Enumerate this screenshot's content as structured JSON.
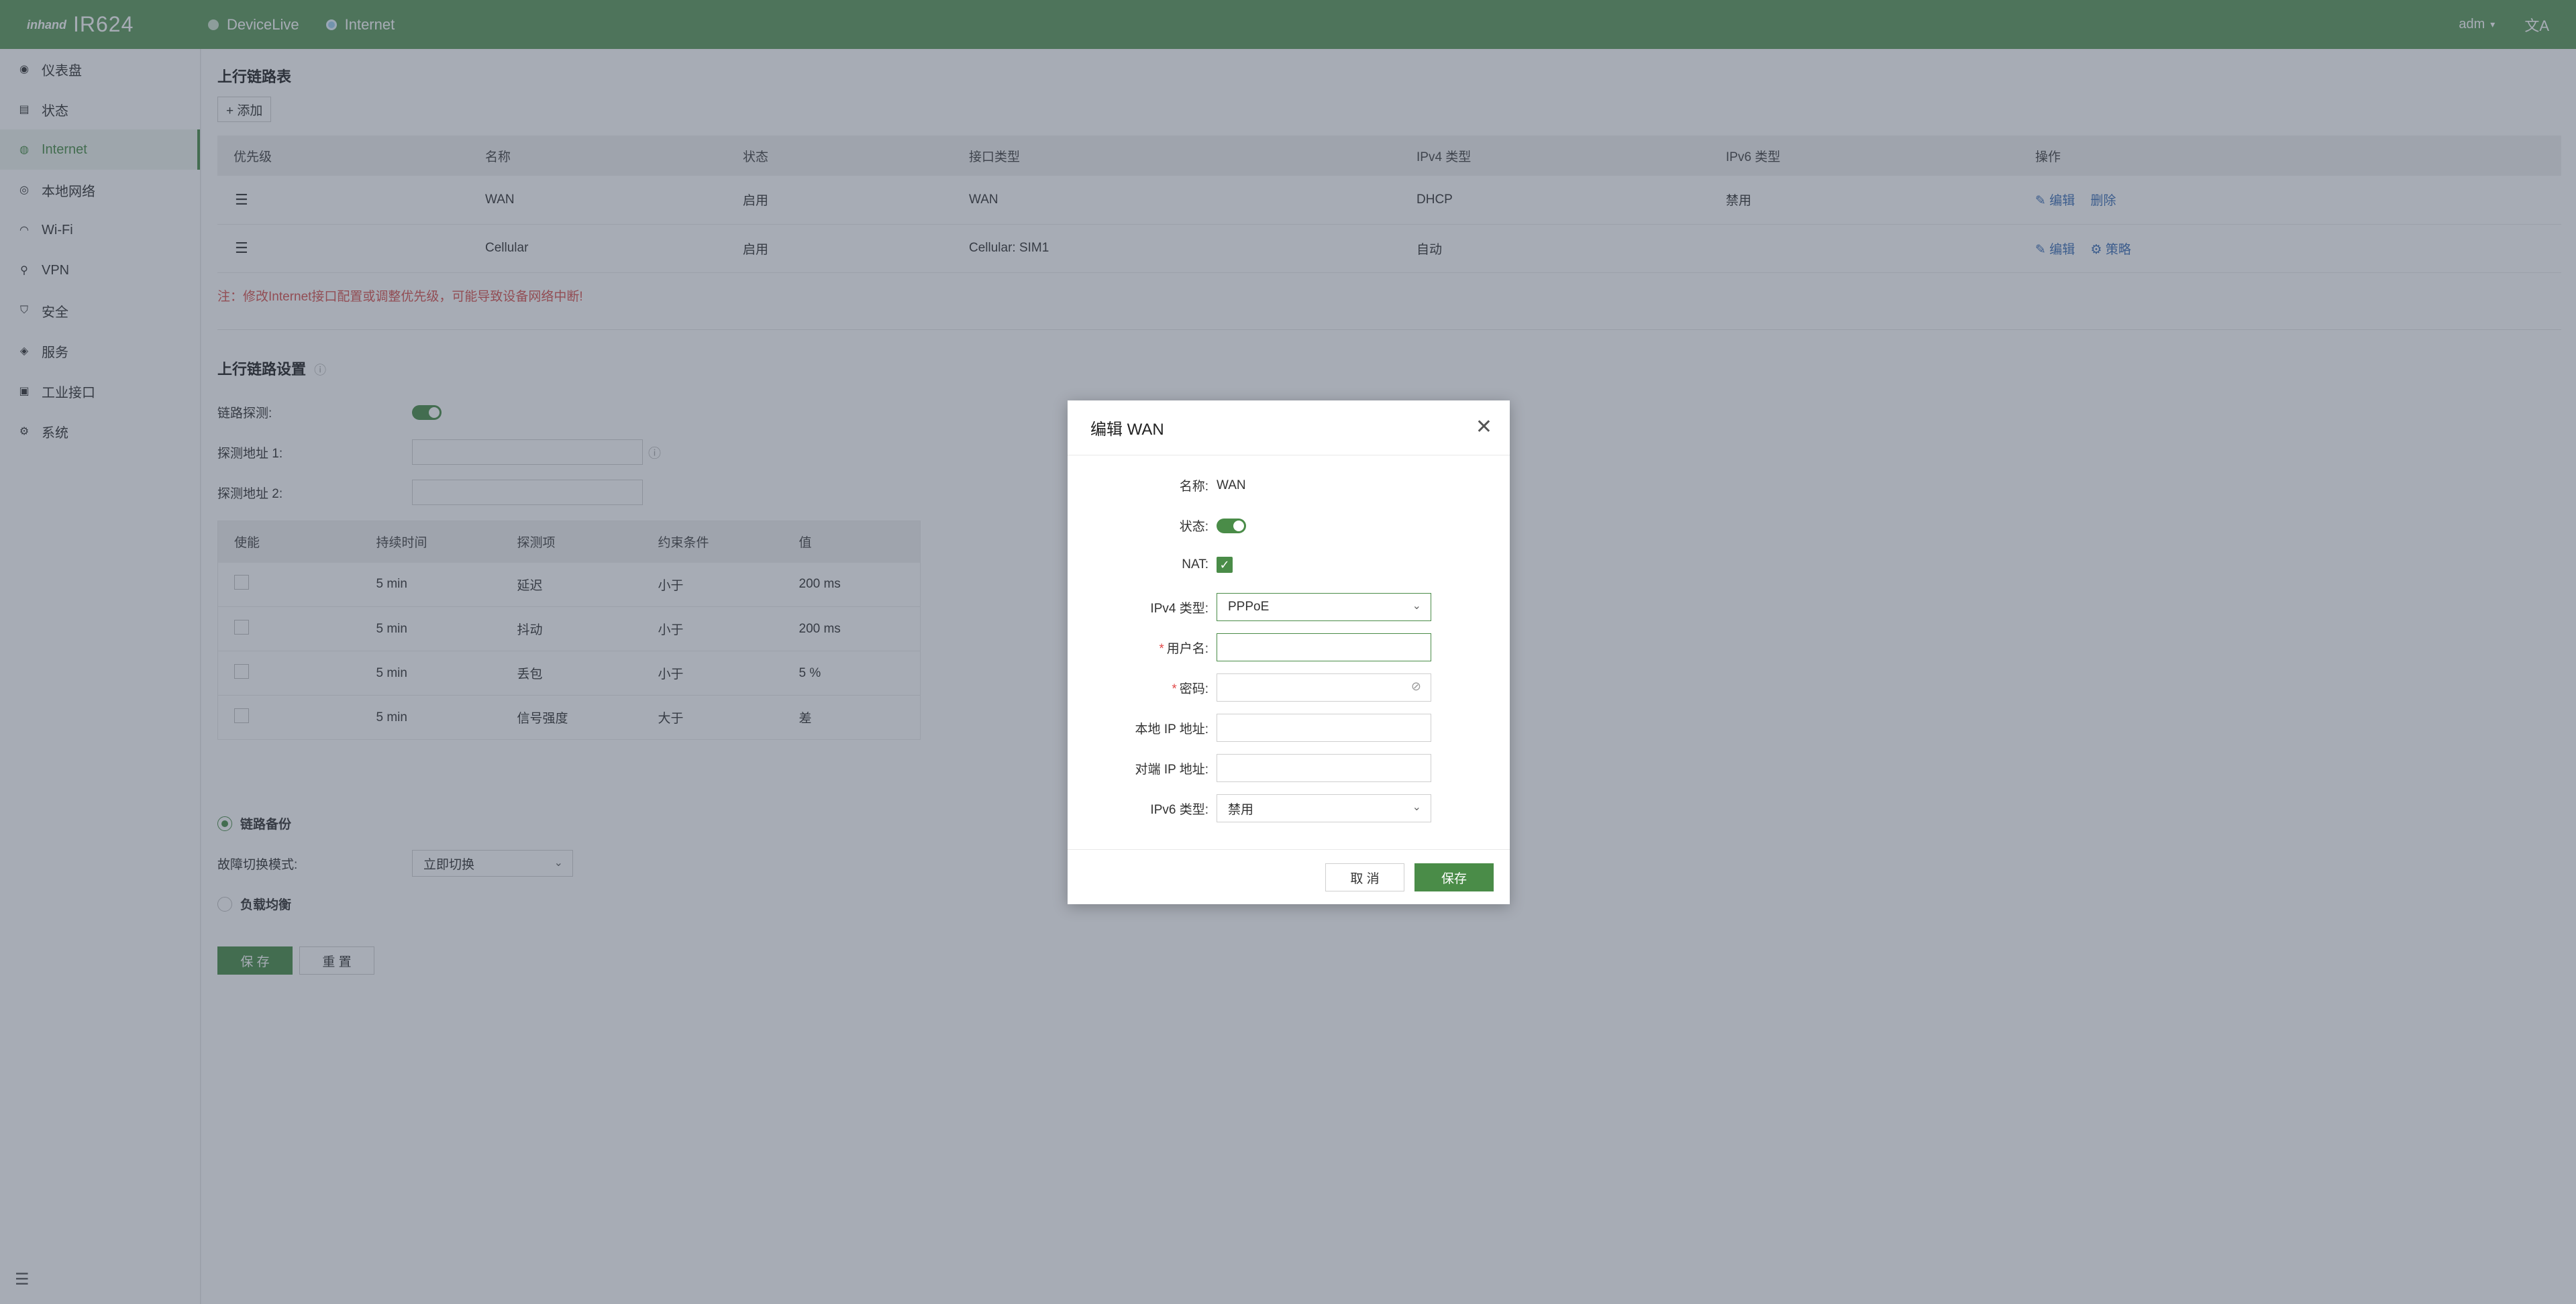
{
  "topbar": {
    "logo_mark": "inhand",
    "product": "IR624",
    "tabs": [
      "DeviceLive",
      "Internet"
    ],
    "user": "adm",
    "lang_icon": "translate-icon"
  },
  "sidebar": {
    "items": [
      {
        "label": "仪表盘",
        "icon": "dashboard-icon"
      },
      {
        "label": "状态",
        "icon": "status-icon"
      },
      {
        "label": "Internet",
        "icon": "internet-icon"
      },
      {
        "label": "本地网络",
        "icon": "lan-icon"
      },
      {
        "label": "Wi-Fi",
        "icon": "wifi-icon"
      },
      {
        "label": "VPN",
        "icon": "vpn-icon"
      },
      {
        "label": "安全",
        "icon": "shield-icon"
      },
      {
        "label": "服务",
        "icon": "service-icon"
      },
      {
        "label": "工业接口",
        "icon": "industrial-icon"
      },
      {
        "label": "系统",
        "icon": "gear-icon"
      }
    ],
    "active": "Internet"
  },
  "uplink": {
    "title": "上行链路表",
    "add_label": "+ 添加",
    "columns": [
      "优先级",
      "名称",
      "状态",
      "接口类型",
      "IPv4 类型",
      "IPv6 类型",
      "操作"
    ],
    "rows": [
      {
        "name": "WAN",
        "status": "启用",
        "iface": "WAN",
        "ipv4": "DHCP",
        "ipv6": "禁用",
        "act1": "编辑",
        "act2": "删除"
      },
      {
        "name": "Cellular",
        "status": "启用",
        "iface": "Cellular: SIM1",
        "ipv4": "自动",
        "ipv6": "",
        "act1": "编辑",
        "act2": "策略"
      }
    ],
    "note": "注：修改Internet接口配置或调整优先级，可能导致设备网络中断!"
  },
  "settings": {
    "title": "上行链路设置",
    "probe_label": "链路探测:",
    "addr1_label": "探测地址 1:",
    "addr2_label": "探测地址 2:",
    "probe_columns": [
      "使能",
      "持续时间",
      "探测项",
      "约束条件",
      "值"
    ],
    "probe_rows": [
      {
        "duration": "5 min",
        "item": "延迟",
        "cond": "小于",
        "value": "200 ms"
      },
      {
        "duration": "5 min",
        "item": "抖动",
        "cond": "小于",
        "value": "200 ms"
      },
      {
        "duration": "5 min",
        "item": "丢包",
        "cond": "小于",
        "value": "5 %"
      },
      {
        "duration": "5 min",
        "item": "信号强度",
        "cond": "大于",
        "value": "差"
      }
    ],
    "backup_label": "链路备份",
    "failover_label": "故障切换模式:",
    "failover_value": "立即切换",
    "balance_label": "负载均衡",
    "save_label": "保 存",
    "reset_label": "重 置"
  },
  "modal": {
    "title": "编辑 WAN",
    "name_label": "名称:",
    "name_value": "WAN",
    "status_label": "状态:",
    "nat_label": "NAT:",
    "ipv4_label": "IPv4 类型:",
    "ipv4_value": "PPPoE",
    "username_label": "用户名:",
    "password_label": "密码:",
    "local_ip_label": "本地 IP 地址:",
    "peer_ip_label": "对端 IP 地址:",
    "ipv6_label": "IPv6 类型:",
    "ipv6_value": "禁用",
    "cancel_label": "取 消",
    "save_label": "保存"
  },
  "colors": {
    "brand": "#5e9a5c",
    "primary": "#4a8c48",
    "link": "#3d6fb6",
    "warn": "#d9534f"
  }
}
